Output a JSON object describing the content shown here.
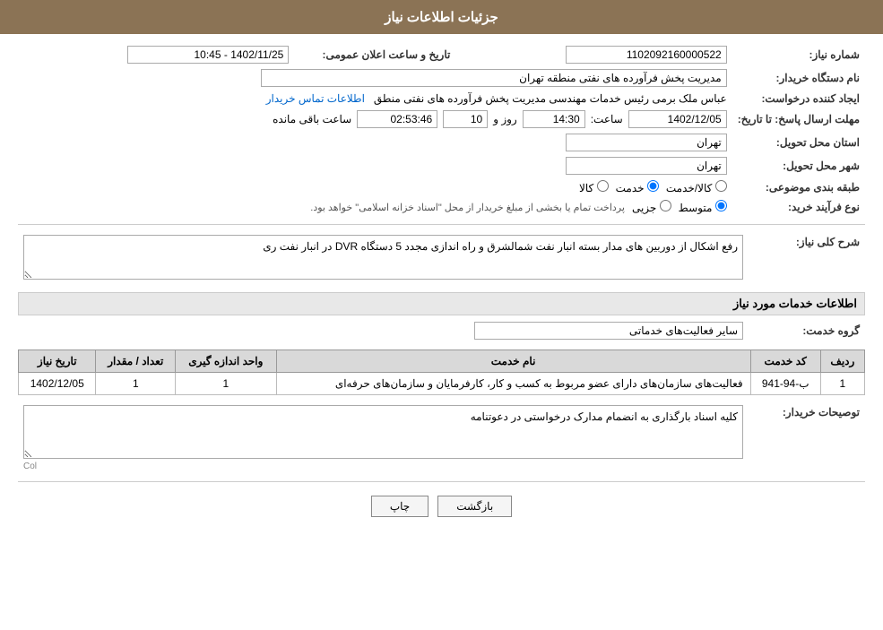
{
  "header": {
    "title": "جزئیات اطلاعات نیاز"
  },
  "fields": {
    "need_number_label": "شماره نیاز:",
    "need_number_value": "1102092160000522",
    "announcement_label": "تاریخ و ساعت اعلان عمومی:",
    "announcement_value": "1402/11/25 - 10:45",
    "buyer_label": "نام دستگاه خریدار:",
    "buyer_value": "مدیریت پخش فرآورده های نفتی منطقه تهران",
    "creator_label": "ایجاد کننده درخواست:",
    "creator_value": "عباس ملک برمی رئیس خدمات مهندسی مدیریت پخش فرآورده های نفتی منطق",
    "creator_link": "اطلاعات تماس خریدار",
    "deadline_label": "مهلت ارسال پاسخ: تا تاریخ:",
    "deadline_date": "1402/12/05",
    "deadline_time_label": "ساعت:",
    "deadline_time": "14:30",
    "deadline_days_label": "روز و",
    "deadline_days": "10",
    "countdown_label": "ساعت باقی مانده",
    "countdown_value": "02:53:46",
    "province_label": "استان محل تحویل:",
    "province_value": "تهران",
    "city_label": "شهر محل تحویل:",
    "city_value": "تهران",
    "category_label": "طبقه بندی موضوعی:",
    "category_options": [
      "کالا",
      "خدمت",
      "کالا/خدمت"
    ],
    "category_selected": "خدمت",
    "process_label": "نوع فرآیند خرید:",
    "process_options": [
      "جزیی",
      "متوسط"
    ],
    "process_selected": "متوسط",
    "process_note": "پرداخت تمام یا بخشی از مبلغ خریدار از محل \"اسناد خزانه اسلامی\" خواهد بود.",
    "need_desc_label": "شرح کلی نیاز:",
    "need_desc_value": "رفع اشکال از دوربین های مدار بسته انبار نفت شمالشرق و راه اندازی مجدد 5 دستگاه DVR در انبار نفت ری",
    "services_section_title": "اطلاعات خدمات مورد نیاز",
    "service_group_label": "گروه خدمت:",
    "service_group_value": "سایر فعالیت‌های خدماتی",
    "table": {
      "headers": [
        "ردیف",
        "کد خدمت",
        "نام خدمت",
        "واحد اندازه گیری",
        "تعداد / مقدار",
        "تاریخ نیاز"
      ],
      "rows": [
        {
          "row": "1",
          "code": "ب-94-941",
          "name": "فعالیت‌های سازمان‌های دارای عضو مربوط به کسب و کار، کارفرمایان و سازمان‌های حرفه‌ای",
          "unit": "1",
          "quantity": "1",
          "date": "1402/12/05"
        }
      ]
    },
    "buyer_notes_label": "توصیحات خریدار:",
    "buyer_notes_value": "کلیه اسناد بارگذاری به انضمام مدارک درخواستی در دعوتنامه",
    "col_label": "Col"
  },
  "buttons": {
    "print": "چاپ",
    "back": "بازگشت"
  }
}
